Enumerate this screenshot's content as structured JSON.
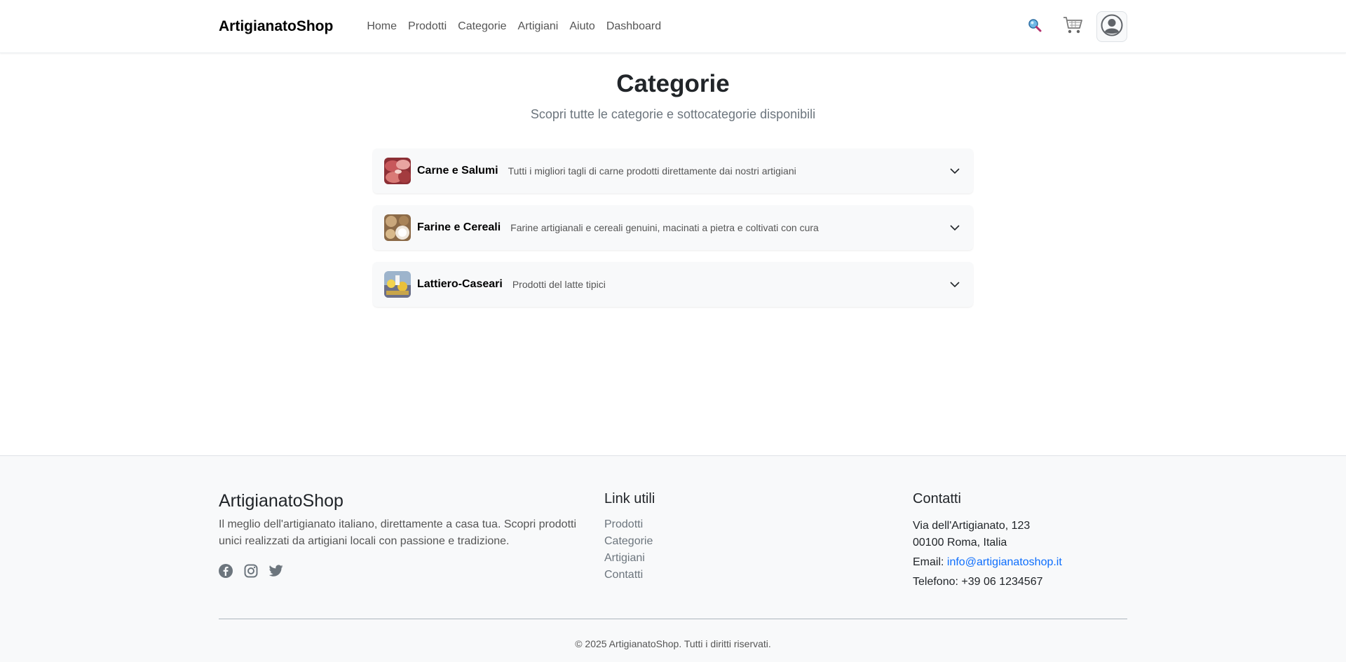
{
  "header": {
    "brand": "ArtigianatoShop",
    "nav": [
      {
        "label": "Home"
      },
      {
        "label": "Prodotti"
      },
      {
        "label": "Categorie"
      },
      {
        "label": "Artigiani"
      },
      {
        "label": "Aiuto"
      },
      {
        "label": "Dashboard"
      }
    ],
    "icons": [
      "search-icon",
      "cart-icon",
      "user-avatar-icon"
    ]
  },
  "main": {
    "title": "Categorie",
    "subtitle": "Scopri tutte le categorie e sottocategorie disponibili",
    "categories": [
      {
        "name": "Carne e Salumi",
        "description": "Tutti i migliori tagli di carne prodotti direttamente dai nostri artigiani"
      },
      {
        "name": "Farine e Cereali",
        "description": "Farine artigianali e cereali genuini, macinati a pietra e coltivati con cura"
      },
      {
        "name": "Lattiero-Caseari",
        "description": "Prodotti del latte tipici"
      }
    ]
  },
  "footer": {
    "brand": "ArtigianatoShop",
    "description": "Il meglio dell'artigianato italiano, direttamente a casa tua. Scopri prodotti unici realizzati da artigiani locali con passione e tradizione.",
    "social_icons": [
      "facebook-icon",
      "instagram-icon",
      "twitter-icon"
    ],
    "links_title": "Link utili",
    "links": [
      {
        "label": "Prodotti"
      },
      {
        "label": "Categorie"
      },
      {
        "label": "Artigiani"
      },
      {
        "label": "Contatti"
      }
    ],
    "contacts_title": "Contatti",
    "address_line1": "Via dell'Artigianato, 123",
    "address_line2": "00100 Roma, Italia",
    "email_label": "Email:",
    "email": "info@artigianatoshop.it",
    "phone": "Telefono: +39 06 1234567",
    "copyright": "© 2025 ArtigianatoShop. Tutti i diritti riservati."
  },
  "colors": {
    "accent": "#0d6efd",
    "footer_bg": "#f8f9fa",
    "card_bg": "#f8f9fa"
  }
}
